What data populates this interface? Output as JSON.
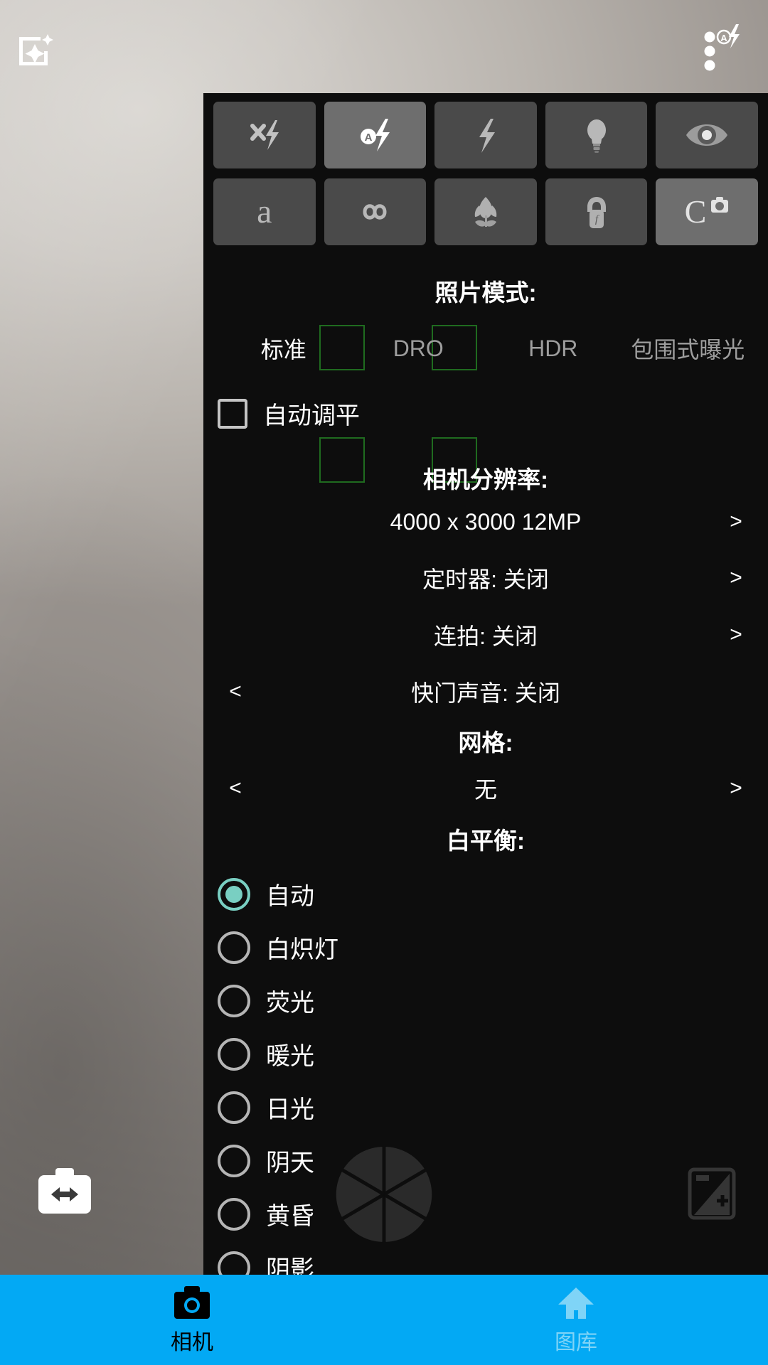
{
  "app": {
    "viewfinder_label": "camera-viewfinder"
  },
  "top_overlay": {
    "enhance_icon": "photo-effects-icon",
    "more_icon": "more-options-flash-auto-icon"
  },
  "flash_tiles": [
    {
      "name": "flash-off",
      "icon": "flash-off-icon",
      "active": false
    },
    {
      "name": "flash-auto",
      "icon": "flash-auto-icon",
      "active": true
    },
    {
      "name": "flash-on",
      "icon": "flash-on-icon",
      "active": false
    },
    {
      "name": "torch",
      "icon": "light-bulb-icon",
      "active": false
    },
    {
      "name": "red-eye-reduction",
      "icon": "eye-icon",
      "active": false
    }
  ],
  "focus_tiles": [
    {
      "name": "focus-auto",
      "icon": "letter-a-icon",
      "label": "a",
      "active": false
    },
    {
      "name": "focus-infinity",
      "icon": "infinity-icon",
      "label": "∞",
      "active": false
    },
    {
      "name": "focus-macro",
      "icon": "tulip-macro-icon",
      "active": false
    },
    {
      "name": "focus-locked",
      "icon": "lock-icon",
      "active": false
    },
    {
      "name": "focus-continuous",
      "icon": "continuous-camera-icon",
      "label": "C",
      "active": true
    }
  ],
  "photo_mode": {
    "title": "照片模式:",
    "tabs": [
      {
        "label": "标准",
        "selected": true
      },
      {
        "label": "DRO",
        "selected": false
      },
      {
        "label": "HDR",
        "selected": false
      },
      {
        "label": "包围式曝光",
        "selected": false
      }
    ]
  },
  "auto_level": {
    "label": "自动调平",
    "checked": false
  },
  "resolution": {
    "title": "相机分辨率:",
    "value": "4000 x 3000 12MP",
    "next_arrow": ">"
  },
  "timer": {
    "value": "定时器: 关闭",
    "next_arrow": ">"
  },
  "burst": {
    "value": "连拍: 关闭",
    "next_arrow": ">"
  },
  "shutter_sound": {
    "value": "快门声音: 关闭",
    "prev_arrow": "<"
  },
  "grid": {
    "title": "网格:",
    "value": "无",
    "prev_arrow": "<",
    "next_arrow": ">"
  },
  "white_balance": {
    "title": "白平衡:",
    "options": [
      {
        "label": "自动",
        "selected": true
      },
      {
        "label": "白炽灯",
        "selected": false
      },
      {
        "label": "荧光",
        "selected": false
      },
      {
        "label": "暖光",
        "selected": false
      },
      {
        "label": "日光",
        "selected": false
      },
      {
        "label": "阴天",
        "selected": false
      },
      {
        "label": "黄昏",
        "selected": false
      },
      {
        "label": "阴影",
        "selected": false
      }
    ]
  },
  "bottom_controls": {
    "switch_camera_icon": "switch-camera-icon",
    "shutter_icon": "shutter-aperture-icon",
    "exposure_icon": "exposure-compensation-icon"
  },
  "bottom_nav": {
    "items": [
      {
        "label": "相机",
        "icon": "camera-icon",
        "active": true
      },
      {
        "label": "图库",
        "icon": "home-gallery-icon",
        "active": false
      }
    ]
  },
  "colors": {
    "nav_bar": "#03a9f4",
    "accent_radio": "#79cfc2",
    "panel_bg": "#0d0d0d",
    "focus_bracket": "#1f6b1f"
  }
}
